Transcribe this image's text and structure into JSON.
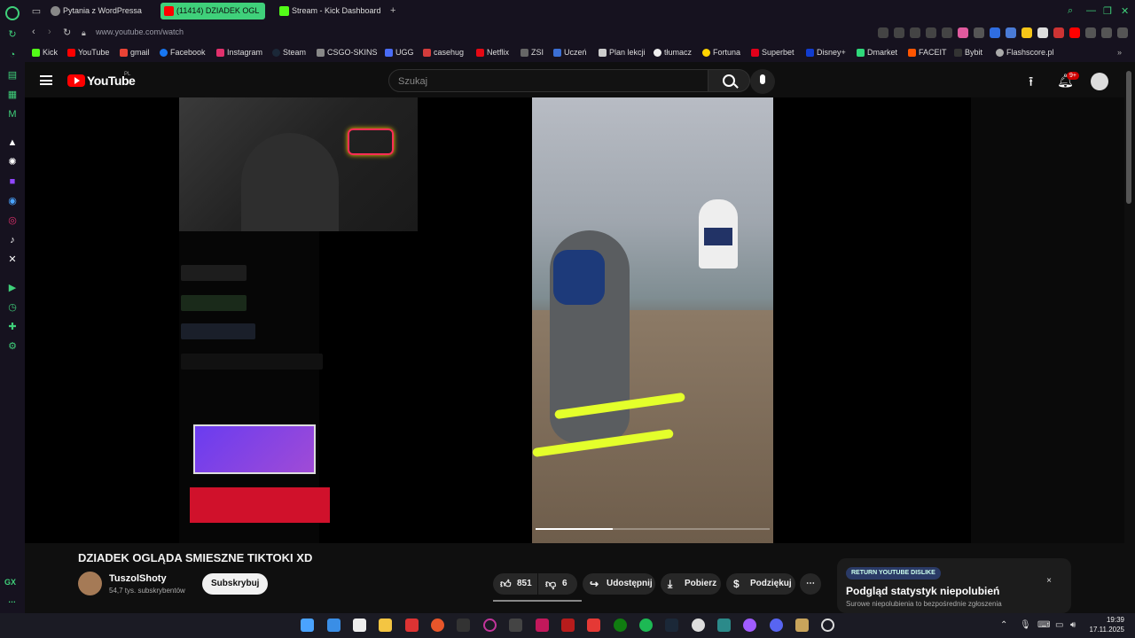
{
  "browser": {
    "tabs": [
      {
        "label": "Pytania z WordPressa",
        "active": false
      },
      {
        "label": "(11414) DZIADEK OGL",
        "active": true
      },
      {
        "label": "Stream - Kick Dashboard",
        "active": false
      }
    ],
    "url": "www.youtube.com/watch",
    "accent_color": "#3fd07a",
    "bookmarks": [
      "Kick",
      "YouTube",
      "gmail",
      "Facebook",
      "Instagram",
      "Steam",
      "CSGO-SKINS",
      "UGG",
      "casehug",
      "Netflix",
      "ZSI",
      "Uczeń",
      "Plan lekcji",
      "tłumacz",
      "Fortuna",
      "Superbet",
      "Disney+",
      "Dmarket",
      "FACEIT",
      "Bybit",
      "Flashscore.pl"
    ],
    "sidebar_bottom_label": "GX"
  },
  "youtube": {
    "logo_text": "YouTube",
    "country": "PL",
    "search_placeholder": "Szukaj",
    "notification_count": "9+",
    "brand_color": "#ff0000"
  },
  "video": {
    "title": "DZIADEK OGLĄDA SMIESZNE TIKTOKI XD",
    "progress": 0.33,
    "channel": {
      "name": "TuszolShoty",
      "subscribers": "54,7 tys. subskrybentów",
      "subscribe_label": "Subskrybuj"
    },
    "actions": {
      "likes": "851",
      "dislikes": "6",
      "share": "Udostępnij",
      "download": "Pobierz",
      "thanks": "Podziękuj"
    }
  },
  "ryd_panel": {
    "badge": "RETURN YOUTUBE DISLIKE",
    "title": "Podgląd statystyk niepolubień",
    "subtitle": "Surowe niepolubienia to bezpośrednie zgłoszenia",
    "close": "×"
  },
  "taskbar": {
    "time": "19:39",
    "date": "17.11.2025"
  }
}
